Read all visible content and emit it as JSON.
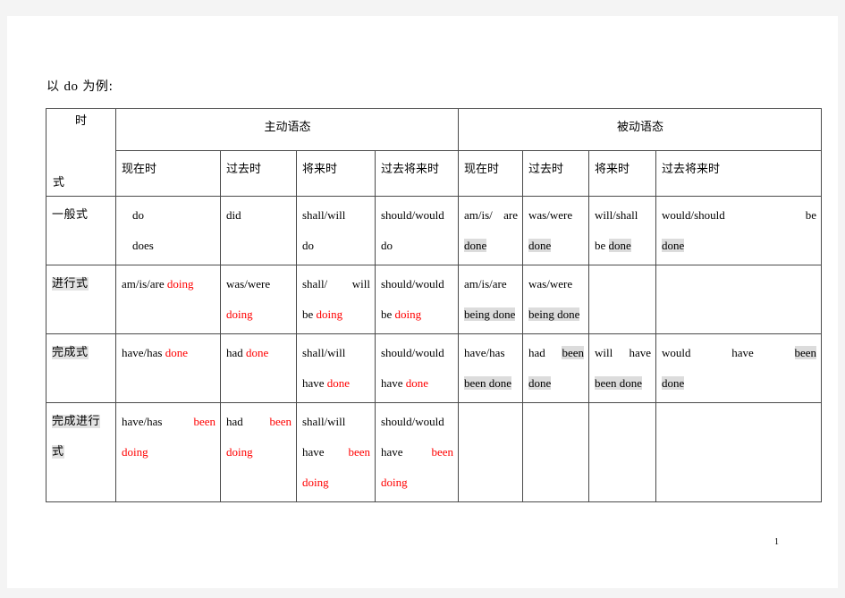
{
  "document": {
    "intro_prefix": "以 ",
    "intro_verb": "do",
    "intro_suffix": " 为例:",
    "page_number": "1"
  },
  "table": {
    "corner": {
      "top_label": "时",
      "bottom_label": "式"
    },
    "voice_headers": [
      {
        "label": "主动语态",
        "span": 4
      },
      {
        "label": "被动语态",
        "span": 4
      }
    ],
    "tense_headers": [
      "现在时",
      "过去时",
      "将来时",
      "过去将来时",
      "现在时",
      "过去时",
      "将来时",
      "过去将来时"
    ],
    "rows": [
      {
        "label": "一般式",
        "label_highlighted": false,
        "cells": [
          {
            "lines": [
              [
                {
                  "t": "do",
                  "c": "black",
                  "h": false
                }
              ],
              [
                {
                  "t": "does",
                  "c": "black",
                  "h": false
                }
              ]
            ],
            "indent": true
          },
          {
            "lines": [
              [
                {
                  "t": "did",
                  "c": "black",
                  "h": false
                }
              ]
            ]
          },
          {
            "lines": [
              [
                {
                  "t": "shall/will",
                  "c": "black",
                  "h": false
                }
              ],
              [
                {
                  "t": "do",
                  "c": "black",
                  "h": false
                }
              ]
            ]
          },
          {
            "lines": [
              [
                {
                  "t": "should/would",
                  "c": "black",
                  "h": false
                }
              ],
              [
                {
                  "t": "do",
                  "c": "black",
                  "h": false
                }
              ]
            ]
          },
          {
            "lines": [
              [
                {
                  "t": "am/is/",
                  "c": "black",
                  "h": false
                },
                {
                  "t": "are",
                  "c": "black",
                  "h": false
                }
              ],
              [
                {
                  "t": "done",
                  "c": "black",
                  "h": true
                }
              ]
            ],
            "justify_first": true
          },
          {
            "lines": [
              [
                {
                  "t": "was/were",
                  "c": "black",
                  "h": false
                }
              ],
              [
                {
                  "t": "done",
                  "c": "black",
                  "h": true
                }
              ]
            ]
          },
          {
            "lines": [
              [
                {
                  "t": "will/shall",
                  "c": "black",
                  "h": false
                }
              ],
              [
                {
                  "t": "be ",
                  "c": "black",
                  "h": false
                },
                {
                  "t": "done",
                  "c": "black",
                  "h": true
                }
              ]
            ]
          },
          {
            "lines": [
              [
                {
                  "t": "would/should",
                  "c": "black",
                  "h": false
                },
                {
                  "t": "be",
                  "c": "black",
                  "h": false
                }
              ],
              [
                {
                  "t": "done",
                  "c": "black",
                  "h": true
                }
              ]
            ],
            "justify_first": true
          }
        ]
      },
      {
        "label": "进行式",
        "label_highlighted": true,
        "cells": [
          {
            "lines": [
              [
                {
                  "t": "am/is/are ",
                  "c": "black",
                  "h": false
                },
                {
                  "t": "doing",
                  "c": "red",
                  "h": false
                }
              ]
            ]
          },
          {
            "lines": [
              [
                {
                  "t": "was/were",
                  "c": "black",
                  "h": false
                }
              ],
              [
                {
                  "t": "doing",
                  "c": "red",
                  "h": false
                }
              ]
            ]
          },
          {
            "lines": [
              [
                {
                  "t": "shall/",
                  "c": "black",
                  "h": false
                },
                {
                  "t": "will",
                  "c": "black",
                  "h": false
                }
              ],
              [
                {
                  "t": "be ",
                  "c": "black",
                  "h": false
                },
                {
                  "t": "doing",
                  "c": "red",
                  "h": false
                }
              ]
            ],
            "justify_first": true
          },
          {
            "lines": [
              [
                {
                  "t": "should/would",
                  "c": "black",
                  "h": false
                }
              ],
              [
                {
                  "t": "be ",
                  "c": "black",
                  "h": false
                },
                {
                  "t": "doing",
                  "c": "red",
                  "h": false
                }
              ]
            ]
          },
          {
            "lines": [
              [
                {
                  "t": "am/is/are",
                  "c": "black",
                  "h": false
                }
              ],
              [
                {
                  "t": "being  done",
                  "c": "black",
                  "h": true
                }
              ]
            ]
          },
          {
            "lines": [
              [
                {
                  "t": "was/were",
                  "c": "black",
                  "h": false
                }
              ],
              [
                {
                  "t": "being  done",
                  "c": "black",
                  "h": true
                }
              ]
            ]
          },
          {
            "lines": []
          },
          {
            "lines": []
          }
        ]
      },
      {
        "label": "完成式",
        "label_highlighted": true,
        "cells": [
          {
            "lines": [
              [
                {
                  "t": "have/has ",
                  "c": "black",
                  "h": false
                },
                {
                  "t": "done",
                  "c": "red",
                  "h": false
                }
              ]
            ]
          },
          {
            "lines": [
              [
                {
                  "t": "had ",
                  "c": "black",
                  "h": false
                },
                {
                  "t": "done",
                  "c": "red",
                  "h": false
                }
              ]
            ]
          },
          {
            "lines": [
              [
                {
                  "t": "shall/will",
                  "c": "black",
                  "h": false
                }
              ],
              [
                {
                  "t": "have ",
                  "c": "black",
                  "h": false
                },
                {
                  "t": "done",
                  "c": "red",
                  "h": false
                }
              ]
            ]
          },
          {
            "lines": [
              [
                {
                  "t": "should/would",
                  "c": "black",
                  "h": false
                }
              ],
              [
                {
                  "t": "have ",
                  "c": "black",
                  "h": false
                },
                {
                  "t": "done",
                  "c": "red",
                  "h": false
                }
              ]
            ]
          },
          {
            "lines": [
              [
                {
                  "t": "have/has",
                  "c": "black",
                  "h": false
                }
              ],
              [
                {
                  "t": "been  done",
                  "c": "black",
                  "h": true
                }
              ]
            ]
          },
          {
            "lines": [
              [
                {
                  "t": "had",
                  "c": "black",
                  "h": false
                },
                {
                  "t": "been",
                  "c": "black",
                  "h": true
                }
              ],
              [
                {
                  "t": "done",
                  "c": "black",
                  "h": true
                }
              ]
            ],
            "justify_first": true
          },
          {
            "lines": [
              [
                {
                  "t": "will",
                  "c": "black",
                  "h": false
                },
                {
                  "t": "have",
                  "c": "black",
                  "h": false
                }
              ],
              [
                {
                  "t": "been  done",
                  "c": "black",
                  "h": true
                }
              ]
            ],
            "justify_first": true
          },
          {
            "lines": [
              [
                {
                  "t": "would",
                  "c": "black",
                  "h": false
                },
                {
                  "t": "have",
                  "c": "black",
                  "h": false
                },
                {
                  "t": "been",
                  "c": "black",
                  "h": true
                }
              ],
              [
                {
                  "t": "done",
                  "c": "black",
                  "h": true
                }
              ]
            ],
            "justify_first": true
          }
        ]
      },
      {
        "label": "完成进行式",
        "label_highlighted": true,
        "cells": [
          {
            "lines": [
              [
                {
                  "t": "have/has",
                  "c": "black",
                  "h": false
                },
                {
                  "t": "been",
                  "c": "red",
                  "h": false
                }
              ],
              [
                {
                  "t": "doing",
                  "c": "red",
                  "h": false
                }
              ]
            ],
            "justify_first": true
          },
          {
            "lines": [
              [
                {
                  "t": "had",
                  "c": "black",
                  "h": false
                },
                {
                  "t": "been",
                  "c": "red",
                  "h": false
                }
              ],
              [
                {
                  "t": "doing",
                  "c": "red",
                  "h": false
                }
              ]
            ],
            "justify_first": true
          },
          {
            "lines": [
              [
                {
                  "t": "shall/will",
                  "c": "black",
                  "h": false
                }
              ],
              [
                {
                  "t": "have",
                  "c": "black",
                  "h": false
                },
                {
                  "t": "been",
                  "c": "red",
                  "h": false
                }
              ],
              [
                {
                  "t": "doing",
                  "c": "red",
                  "h": false
                }
              ]
            ],
            "justify_second": true
          },
          {
            "lines": [
              [
                {
                  "t": "should/would",
                  "c": "black",
                  "h": false
                }
              ],
              [
                {
                  "t": "have",
                  "c": "black",
                  "h": false
                },
                {
                  "t": "been",
                  "c": "red",
                  "h": false
                }
              ],
              [
                {
                  "t": "doing",
                  "c": "red",
                  "h": false
                }
              ]
            ],
            "justify_second": true
          },
          {
            "lines": []
          },
          {
            "lines": []
          },
          {
            "lines": []
          },
          {
            "lines": []
          }
        ]
      }
    ]
  }
}
